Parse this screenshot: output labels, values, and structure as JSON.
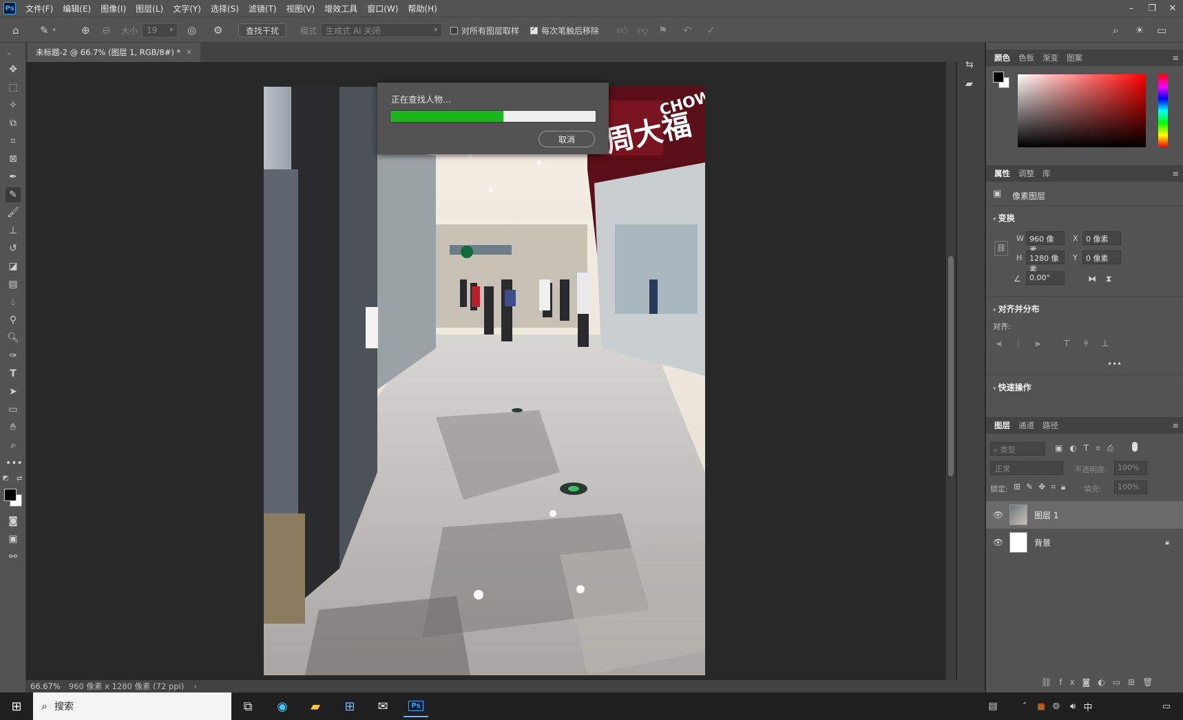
{
  "app": {
    "logo": "Ps",
    "menus": [
      "文件(F)",
      "编辑(E)",
      "图像(I)",
      "图层(L)",
      "文字(Y)",
      "选择(S)",
      "滤镜(T)",
      "视图(V)",
      "增效工具",
      "窗口(W)",
      "帮助(H)"
    ]
  },
  "options": {
    "size_label": "大小",
    "size_value": "19",
    "find_distractions": "查找干扰",
    "mode_label": "模式",
    "mode_value": "生成式 AI 关闭",
    "sample_all_layers": "对所有图层取样",
    "remove_after_stroke": "每次笔触后移除"
  },
  "document": {
    "tab_title": "未标题-2 @ 66.7% (图层 1, RGB/8#) *"
  },
  "dialog": {
    "title": "正在查找人物...",
    "progress": 0.55,
    "cancel": "取消"
  },
  "status": {
    "zoom": "66.67%",
    "info": "960 像素 x 1280 像素 (72 ppi)"
  },
  "color_panel": {
    "tabs": [
      "颜色",
      "色板",
      "渐变",
      "图案"
    ]
  },
  "properties_panel": {
    "tabs": [
      "属性",
      "调整",
      "库"
    ],
    "layer_type": "像素图层",
    "transform_label": "变换",
    "w_label": "W",
    "w_value": "960 像素",
    "h_label": "H",
    "h_value": "1280 像素",
    "x_label": "X",
    "x_value": "0 像素",
    "y_label": "Y",
    "y_value": "0 像素",
    "angle": "0.00°",
    "align_section": "对齐并分布",
    "align_label": "对齐:",
    "quick_actions": "快速操作"
  },
  "layers_panel": {
    "tabs": [
      "图层",
      "通道",
      "路径"
    ],
    "filter_placeholder": "类型",
    "blend_mode": "正常",
    "opacity_label": "不透明度:",
    "opacity_value": "100%",
    "lock_label": "锁定:",
    "fill_label": "填充:",
    "fill_value": "100%",
    "layers": [
      {
        "name": "图层 1"
      },
      {
        "name": "背景"
      }
    ]
  },
  "taskbar": {
    "search": "搜索",
    "ime": "中"
  },
  "photo_signage": {
    "brand_cn": "周大福",
    "brand_en": "CHOW"
  },
  "colors": {
    "progress": "#1fb51f",
    "ps_blue": "#31a8ff"
  }
}
